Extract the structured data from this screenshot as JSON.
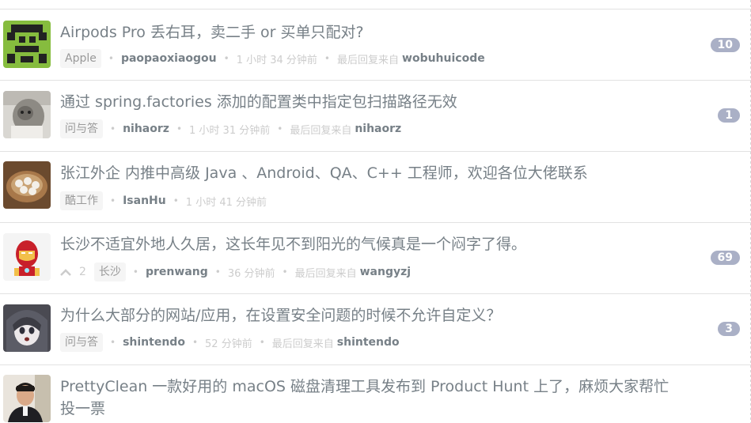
{
  "topics": [
    {
      "title": "Airpods Pro 丢右耳，卖二手 or 买单只配对?",
      "node": "Apple",
      "author": "paopaoxiaogou",
      "time": "1 小时 34 分钟前",
      "last_reply_label": "最后回复来自",
      "last_reply_user": "wobuhuicode",
      "replies": "10",
      "avatar": "green-pixel-avatar"
    },
    {
      "title": "通过 spring.factories 添加的配置类中指定包扫描路径无效",
      "node": "问与答",
      "author": "nihaorz",
      "time": "1 小时 31 分钟前",
      "last_reply_label": "最后回复来自",
      "last_reply_user": "nihaorz",
      "replies": "1",
      "avatar": "cat-photo-avatar"
    },
    {
      "title": "张江外企 内推中高级 Java 、Android、QA、C++ 工程师，欢迎各位大佬联系",
      "node": "酷工作",
      "author": "IsanHu",
      "time": "1 小时 41 分钟前",
      "avatar": "basket-eggs-avatar"
    },
    {
      "title": "长沙不适宜外地人久居，这长年见不到阳光的气候真是一个闷字了得。",
      "votes": "2",
      "node": "长沙",
      "author": "prenwang",
      "time": "36 分钟前",
      "last_reply_label": "最后回复来自",
      "last_reply_user": "wangyzj",
      "replies": "69",
      "avatar": "iron-man-avatar"
    },
    {
      "title": "为什么大部分的网站/应用，在设置安全问题的时候不允许自定义？",
      "node": "问与答",
      "author": "shintendo",
      "time": "52 分钟前",
      "last_reply_label": "最后回复来自",
      "last_reply_user": "shintendo",
      "replies": "3",
      "avatar": "anime-girl-avatar"
    },
    {
      "title": "PrettyClean 一款好用的 macOS 磁盘清理工具发布到 Product Hunt 上了，麻烦大家帮忙",
      "title_line2": "投一票",
      "avatar": "man-photo-avatar"
    }
  ],
  "colors": {
    "title": "#778087",
    "count_badge": "#aab0c6",
    "muted": "#cccccc"
  },
  "icons": {
    "vote": "chevron-up-icon"
  }
}
